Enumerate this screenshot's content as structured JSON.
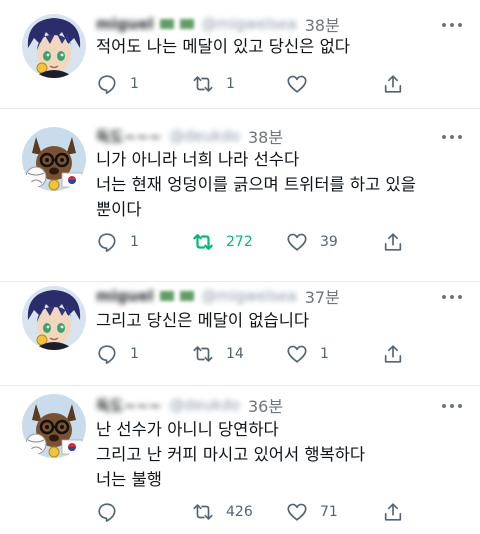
{
  "colors": {
    "accent_retweet": "#00ba7c",
    "icon_gray": "#536471",
    "divider": "#e7eaec"
  },
  "tweets": [
    {
      "author": "miguel",
      "handle": "@migwelsea",
      "time": "38분",
      "avatar": "anime-character-avatar",
      "lines": [
        "적어도 나는 메달이 있고 당신은 없다"
      ],
      "replies": "1",
      "retweets": "1",
      "likes": "",
      "retweeted": false
    },
    {
      "author": "독도~~~",
      "handle": "@deukdo",
      "time": "38분",
      "avatar": "dog-with-volleyball-avatar",
      "lines": [
        "니가 아니라 너희 나라 선수다",
        "너는 현재 엉덩이를 긁으며 트위터를 하고 있을",
        "뿐이다"
      ],
      "replies": "1",
      "retweets": "272",
      "likes": "39",
      "retweeted": true
    },
    {
      "author": "miguel",
      "handle": "@migwelsea",
      "time": "37분",
      "avatar": "anime-character-avatar",
      "lines": [
        "그리고 당신은 메달이 없습니다"
      ],
      "replies": "1",
      "retweets": "14",
      "likes": "1",
      "retweeted": false
    },
    {
      "author": "독도~~~",
      "handle": "@deukdo",
      "time": "36분",
      "avatar": "dog-with-volleyball-avatar",
      "lines": [
        "난 선수가 아니니 당연하다",
        "그리고 난 커피 마시고 있어서 행복하다",
        "너는 불행"
      ],
      "replies": "",
      "retweets": "426",
      "likes": "71",
      "retweeted": false
    }
  ]
}
